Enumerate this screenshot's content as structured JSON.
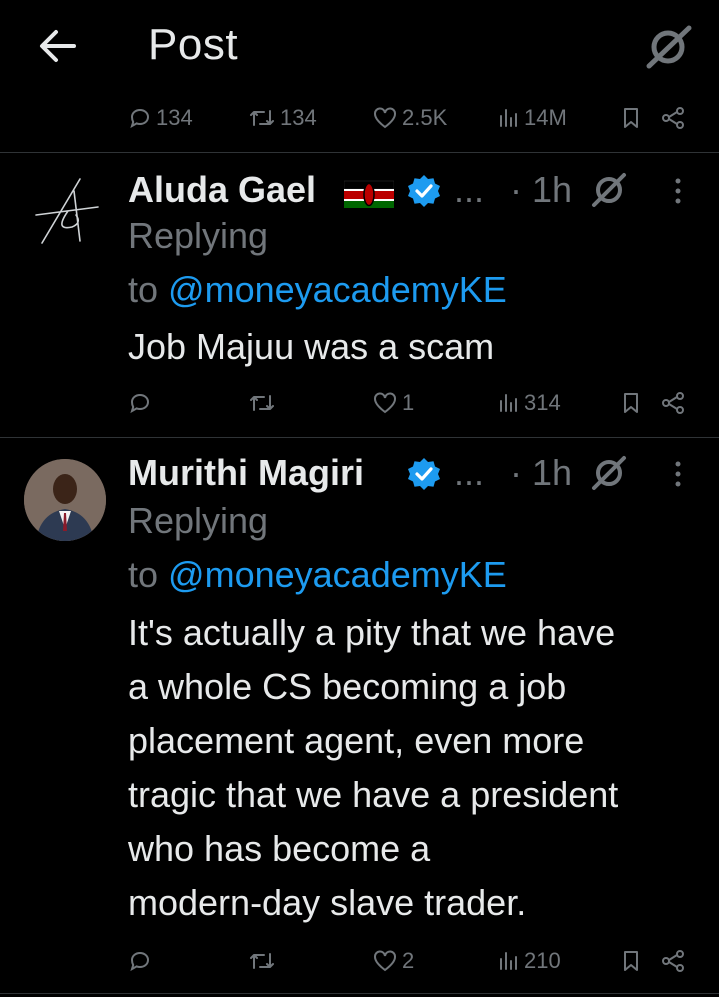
{
  "header": {
    "title": "Post",
    "back_icon": "arrow-left-icon",
    "grok_icon": "grok-icon"
  },
  "prev_actions": {
    "replies": "134",
    "reposts": "134",
    "likes": "2.5K",
    "views": "14M"
  },
  "replies": [
    {
      "name": "Aluda Gael",
      "flag": "kenya-flag-icon",
      "more": "...",
      "time": "· 1h",
      "replying_prefix": "Replying",
      "to_word": "to",
      "handle": "@moneyacademyKE",
      "text_lines": [
        "Job Majuu was a scam"
      ],
      "actions": {
        "replies": "",
        "reposts": "",
        "likes": "1",
        "views": "314"
      }
    },
    {
      "name": "Murithi Magiri",
      "more": "...",
      "time": "· 1h",
      "replying_prefix": "Replying",
      "to_word": "to",
      "handle": "@moneyacademyKE",
      "text_lines": [
        "It's actually a pity that we have",
        "a whole CS becoming a job",
        "placement agent, even more",
        "tragic that we have a president",
        "who has become a",
        "modern-day slave trader."
      ],
      "actions": {
        "replies": "",
        "reposts": "",
        "likes": "2",
        "views": "210"
      }
    }
  ],
  "colors": {
    "background": "#000000",
    "text": "#e7e9ea",
    "muted": "#71767b",
    "link": "#1d9bf0",
    "verified": "#1d9bf0",
    "separator": "#2f3336"
  }
}
